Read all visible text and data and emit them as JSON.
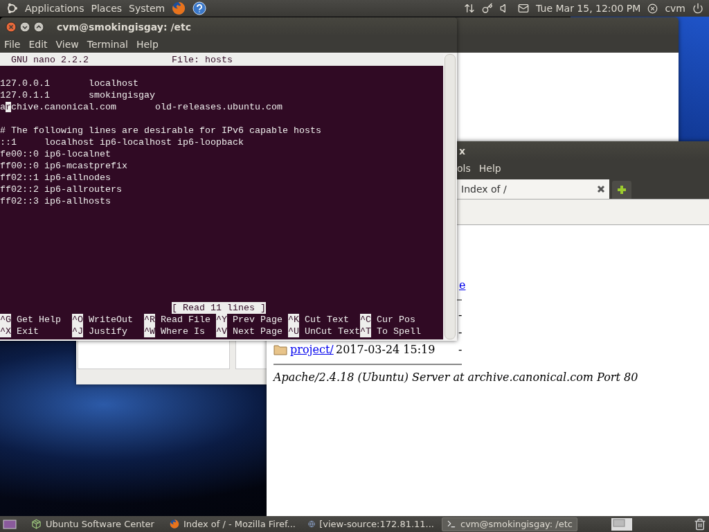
{
  "top_panel": {
    "menus": [
      "Applications",
      "Places",
      "System"
    ],
    "clock": "Tue Mar 15, 12:00 PM",
    "user": "cvm"
  },
  "terminal": {
    "title": "cvm@smokingisgay: /etc",
    "menu": [
      "File",
      "Edit",
      "View",
      "Terminal",
      "Help"
    ],
    "nano": {
      "version": "GNU nano 2.2.2",
      "file": "File: hosts",
      "blocks": [
        [
          {
            "kind": "plain",
            "text": "127.0.0.1       localhost"
          },
          {
            "kind": "plain",
            "text": "127.0.1.1       smokingisgay"
          },
          {
            "kind": "cursor",
            "before": "a",
            "at": "r",
            "after": "chive.canonical.com       old-releases.ubuntu.com"
          }
        ],
        [
          {
            "kind": "plain",
            "text": "# The following lines are desirable for IPv6 capable hosts"
          },
          {
            "kind": "plain",
            "text": "::1     localhost ip6-localhost ip6-loopback"
          },
          {
            "kind": "plain",
            "text": "fe00::0 ip6-localnet"
          },
          {
            "kind": "plain",
            "text": "ff00::0 ip6-mcastprefix"
          },
          {
            "kind": "plain",
            "text": "ff02::1 ip6-allnodes"
          },
          {
            "kind": "plain",
            "text": "ff02::2 ip6-allrouters"
          },
          {
            "kind": "plain",
            "text": "ff02::3 ip6-allhosts"
          }
        ]
      ],
      "status": "[ Read 11 lines ]",
      "shortcuts": [
        [
          {
            "key": "^G",
            "label": "Get Help"
          },
          {
            "key": "^O",
            "label": "WriteOut"
          },
          {
            "key": "^R",
            "label": "Read File"
          },
          {
            "key": "^Y",
            "label": "Prev Page"
          },
          {
            "key": "^K",
            "label": "Cut Text"
          },
          {
            "key": "^C",
            "label": "Cur Pos"
          }
        ],
        [
          {
            "key": "^X",
            "label": "Exit"
          },
          {
            "key": "^J",
            "label": "Justify"
          },
          {
            "key": "^W",
            "label": "Where Is"
          },
          {
            "key": "^V",
            "label": "Next Page"
          },
          {
            "key": "^U",
            "label": "UnCut Text"
          },
          {
            "key": "^T",
            "label": "To Spell"
          }
        ]
      ]
    }
  },
  "browser": {
    "title_fragment": "x",
    "menu_fragments": [
      "ols",
      "Help"
    ],
    "tab": {
      "label": "Index of /",
      "selected": true
    },
    "index": {
      "header_fragment": "e",
      "rows": [
        {
          "size": "-"
        },
        {
          "size": "-"
        },
        {
          "name": "project/",
          "modified": "2017-03-24 15:19",
          "size": "-"
        }
      ],
      "address": "Apache/2.4.18 (Ubuntu) Server at archive.canonical.com Port 80"
    }
  },
  "taskbar": {
    "tasks": [
      {
        "label": "Ubuntu Software Center",
        "selected": false
      },
      {
        "label": "Index of / - Mozilla Firef...",
        "selected": false
      },
      {
        "label": "[view-source:172.81.11...",
        "selected": false
      },
      {
        "label": "cvm@smokingisgay: /etc",
        "selected": true
      }
    ]
  }
}
